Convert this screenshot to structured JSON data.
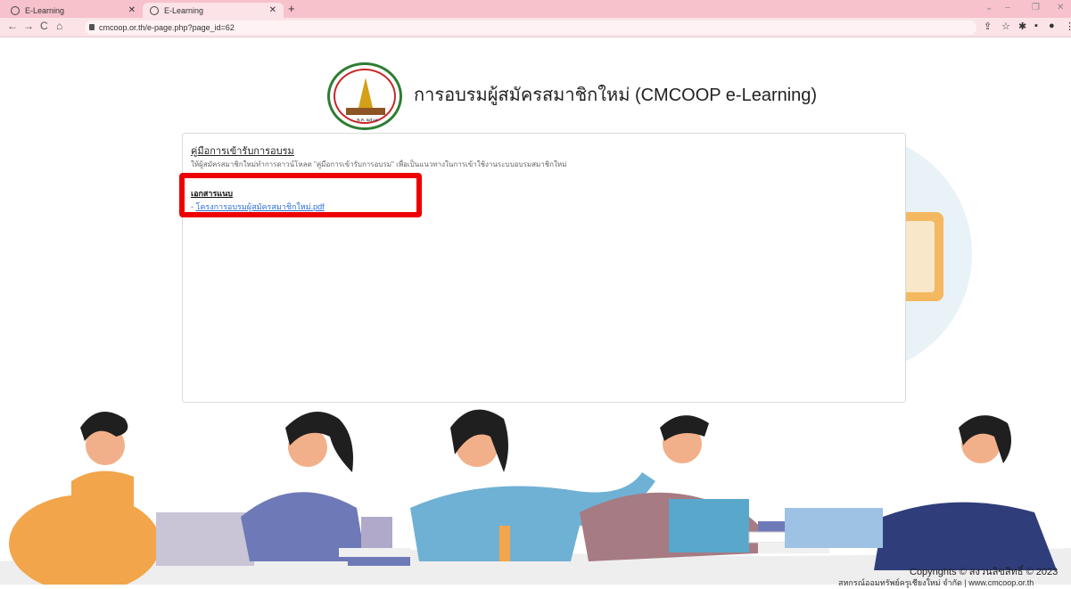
{
  "browser": {
    "tabs": [
      {
        "label": "E-Learning",
        "active": false
      },
      {
        "label": "E-Learning",
        "active": true
      }
    ],
    "new_tab_icon": "+",
    "window_controls": [
      "⌄",
      "–",
      "❐",
      "✕"
    ],
    "url": "cmcoop.or.th/e-page.php?page_id=62"
  },
  "site": {
    "title": "การอบรมผู้สมัครสมาชิกใหม่  (CMCOOP e-Learning)",
    "logo_year": "พ.ศ. ๒๕๐๓"
  },
  "card": {
    "heading": "คู่มือการเข้ารับการอบรม",
    "description": "ให้ผู้สมัครสมาชิกใหม่ทำการดาวน์โหลด \"คู่มือการเข้ารับการอบรม\" เพื่อเป็นแนวทางในการเข้าใช้งานระบบอบรมสมาชิกใหม่",
    "docs_heading": "เอกสารแนบ",
    "doc_prefix": "- ",
    "doc_link": "โครงการอบรมผู้สมัครสมาชิกใหม่.pdf"
  },
  "footer": {
    "copyright": "Copyrights © สงวนลิขสิทธิ์ © 2023",
    "org": "สหกรณ์ออมทรัพย์ครูเชียงใหม่ จำกัด | www.cmcoop.or.th"
  },
  "colors": {
    "tabbar": "#f7c2cc",
    "highlight": "#ee0000",
    "link": "#2a6fd6"
  }
}
